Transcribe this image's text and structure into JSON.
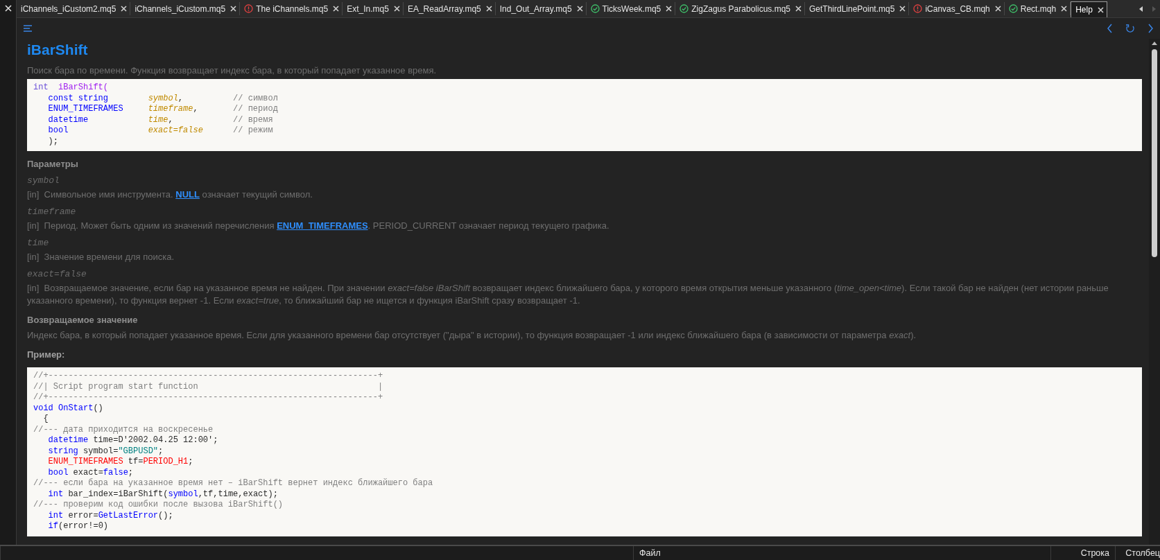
{
  "tabs": [
    {
      "label": "iChannels_iCustom2.mq5",
      "kind": "plain",
      "selected": false
    },
    {
      "label": "iChannels_iCustom.mq5",
      "kind": "plain",
      "selected": false
    },
    {
      "label": "The iChannels.mq5",
      "kind": "error",
      "selected": false
    },
    {
      "label": "Ext_In.mq5",
      "kind": "plain",
      "selected": false
    },
    {
      "label": "EA_ReadArray.mq5",
      "kind": "plain",
      "selected": false
    },
    {
      "label": "Ind_Out_Array.mq5",
      "kind": "plain",
      "selected": false
    },
    {
      "label": "TicksWeek.mq5",
      "kind": "ok",
      "selected": false
    },
    {
      "label": "ZigZagus Parabolicus.mq5",
      "kind": "ok",
      "selected": false
    },
    {
      "label": "GetThirdLinePoint.mq5",
      "kind": "plain",
      "selected": false
    },
    {
      "label": "iCanvas_CB.mqh",
      "kind": "error",
      "selected": false
    },
    {
      "label": "Rect.mqh",
      "kind": "ok",
      "selected": false
    },
    {
      "label": "Help",
      "kind": "plain",
      "selected": true
    }
  ],
  "doc": {
    "title": "iBarShift",
    "summary": "Поиск бара по времени. Функция возвращает индекс бара, в который попадает указанное время.",
    "signature": [
      [
        {
          "text": "int",
          "kind": "sigtype"
        },
        {
          "text": "  iBarShift(",
          "kind": "sigfunc"
        }
      ],
      [
        {
          "text": "   const string",
          "kind": "kw"
        },
        {
          "text": "        symbol",
          "kind": "param"
        },
        {
          "text": ",          ",
          "kind": "plain"
        },
        {
          "text": "// символ",
          "kind": "comment"
        }
      ],
      [
        {
          "text": "   ENUM_TIMEFRAMES",
          "kind": "kw"
        },
        {
          "text": "     timeframe",
          "kind": "param"
        },
        {
          "text": ",       ",
          "kind": "plain"
        },
        {
          "text": "// период",
          "kind": "comment"
        }
      ],
      [
        {
          "text": "   datetime",
          "kind": "kw"
        },
        {
          "text": "            time",
          "kind": "param"
        },
        {
          "text": ",            ",
          "kind": "plain"
        },
        {
          "text": "// время",
          "kind": "comment"
        }
      ],
      [
        {
          "text": "   bool",
          "kind": "kw"
        },
        {
          "text": "                exact=false",
          "kind": "param"
        },
        {
          "text": "      // режим",
          "kind": "comment"
        }
      ],
      [
        {
          "text": "   );",
          "kind": "plain"
        }
      ]
    ],
    "params_heading": "Параметры",
    "params": [
      {
        "name": "symbol",
        "parts": [
          {
            "kind": "text",
            "text": "[in]  Символьное имя инструмента. "
          },
          {
            "kind": "link",
            "text": "NULL"
          },
          {
            "kind": "text",
            "text": " означает текущий символ."
          }
        ]
      },
      {
        "name": "timeframe",
        "parts": [
          {
            "kind": "text",
            "text": "[in]  Период. Может быть одним из значений перечисления "
          },
          {
            "kind": "link",
            "text": "ENUM_TIMEFRAMES"
          },
          {
            "kind": "text",
            "text": ". PERIOD_CURRENT означает период текущего графика."
          }
        ]
      },
      {
        "name": "time",
        "parts": [
          {
            "kind": "text",
            "text": "[in]  Значение времени для поиска."
          }
        ]
      },
      {
        "name": "exact=false",
        "parts": [
          {
            "kind": "text",
            "text": "[in]  Возвращаемое значение, если бар на указанное время не найден. При значении *exact=false iBarShift* возвращает индекс ближайшего бара, у которого время открытия меньше указанного (*time_open<time*). Если такой бар не найден (нет истории раньше указанного времени), то функция вернет -1. Если *exact=true*, то ближайший бар не ищется и функция iBarShift сразу возвращает -1."
          }
        ]
      }
    ],
    "return_heading": "Возвращаемое значение",
    "return_text": "Индекс бара, в который попадает указанное время. Если для указанного времени бар отсутствует (\"дыра\" в истории), то функция возвращает -1 или индекс ближайшего бара (в зависимости от параметра *exact*).",
    "example_heading": "Пример:",
    "example": [
      [
        {
          "text": "//+------------------------------------------------------------------+",
          "kind": "comment"
        }
      ],
      [
        {
          "text": "//| Script program start function                                    |",
          "kind": "comment"
        }
      ],
      [
        {
          "text": "//+------------------------------------------------------------------+",
          "kind": "comment"
        }
      ],
      [
        {
          "text": "void OnStart",
          "kind": "kw"
        },
        {
          "text": "()",
          "kind": "plain"
        }
      ],
      [
        {
          "text": "  {",
          "kind": "plain"
        }
      ],
      [
        {
          "text": "//--- дата приходится на воскресенье",
          "kind": "comment"
        }
      ],
      [
        {
          "text": "   datetime",
          "kind": "kw"
        },
        {
          "text": " time=D'2002.04.25 12:00';",
          "kind": "plain"
        }
      ],
      [
        {
          "text": "   string",
          "kind": "kw"
        },
        {
          "text": " symbol=",
          "kind": "plain"
        },
        {
          "text": "\"GBPUSD\"",
          "kind": "string"
        },
        {
          "text": ";",
          "kind": "plain"
        }
      ],
      [
        {
          "text": "   ENUM_TIMEFRAMES",
          "kind": "const"
        },
        {
          "text": " tf=",
          "kind": "plain"
        },
        {
          "text": "PERIOD_H1",
          "kind": "const"
        },
        {
          "text": ";",
          "kind": "plain"
        }
      ],
      [
        {
          "text": "   bool",
          "kind": "kw"
        },
        {
          "text": " exact=",
          "kind": "plain"
        },
        {
          "text": "false",
          "kind": "kw"
        },
        {
          "text": ";",
          "kind": "plain"
        }
      ],
      [
        {
          "text": "//--- если бара на указанное время нет – iBarShift вернет индекс ближайшего бара",
          "kind": "comment"
        }
      ],
      [
        {
          "text": "   int",
          "kind": "kw"
        },
        {
          "text": " bar_index=iBarShift(",
          "kind": "plain"
        },
        {
          "text": "symbol",
          "kind": "kw"
        },
        {
          "text": ",tf,time,exact);",
          "kind": "plain"
        }
      ],
      [
        {
          "text": "//--- проверим код ошибки после вызова iBarShift()",
          "kind": "comment"
        }
      ],
      [
        {
          "text": "   int",
          "kind": "kw"
        },
        {
          "text": " error=",
          "kind": "plain"
        },
        {
          "text": "GetLastError",
          "kind": "kw"
        },
        {
          "text": "();",
          "kind": "plain"
        }
      ],
      [
        {
          "text": "   if",
          "kind": "kw"
        },
        {
          "text": "(error!=0)",
          "kind": "plain"
        }
      ]
    ]
  },
  "status_bar": {
    "file_label": "Файл",
    "line_label": "Строка",
    "column_label": "Столбец"
  }
}
